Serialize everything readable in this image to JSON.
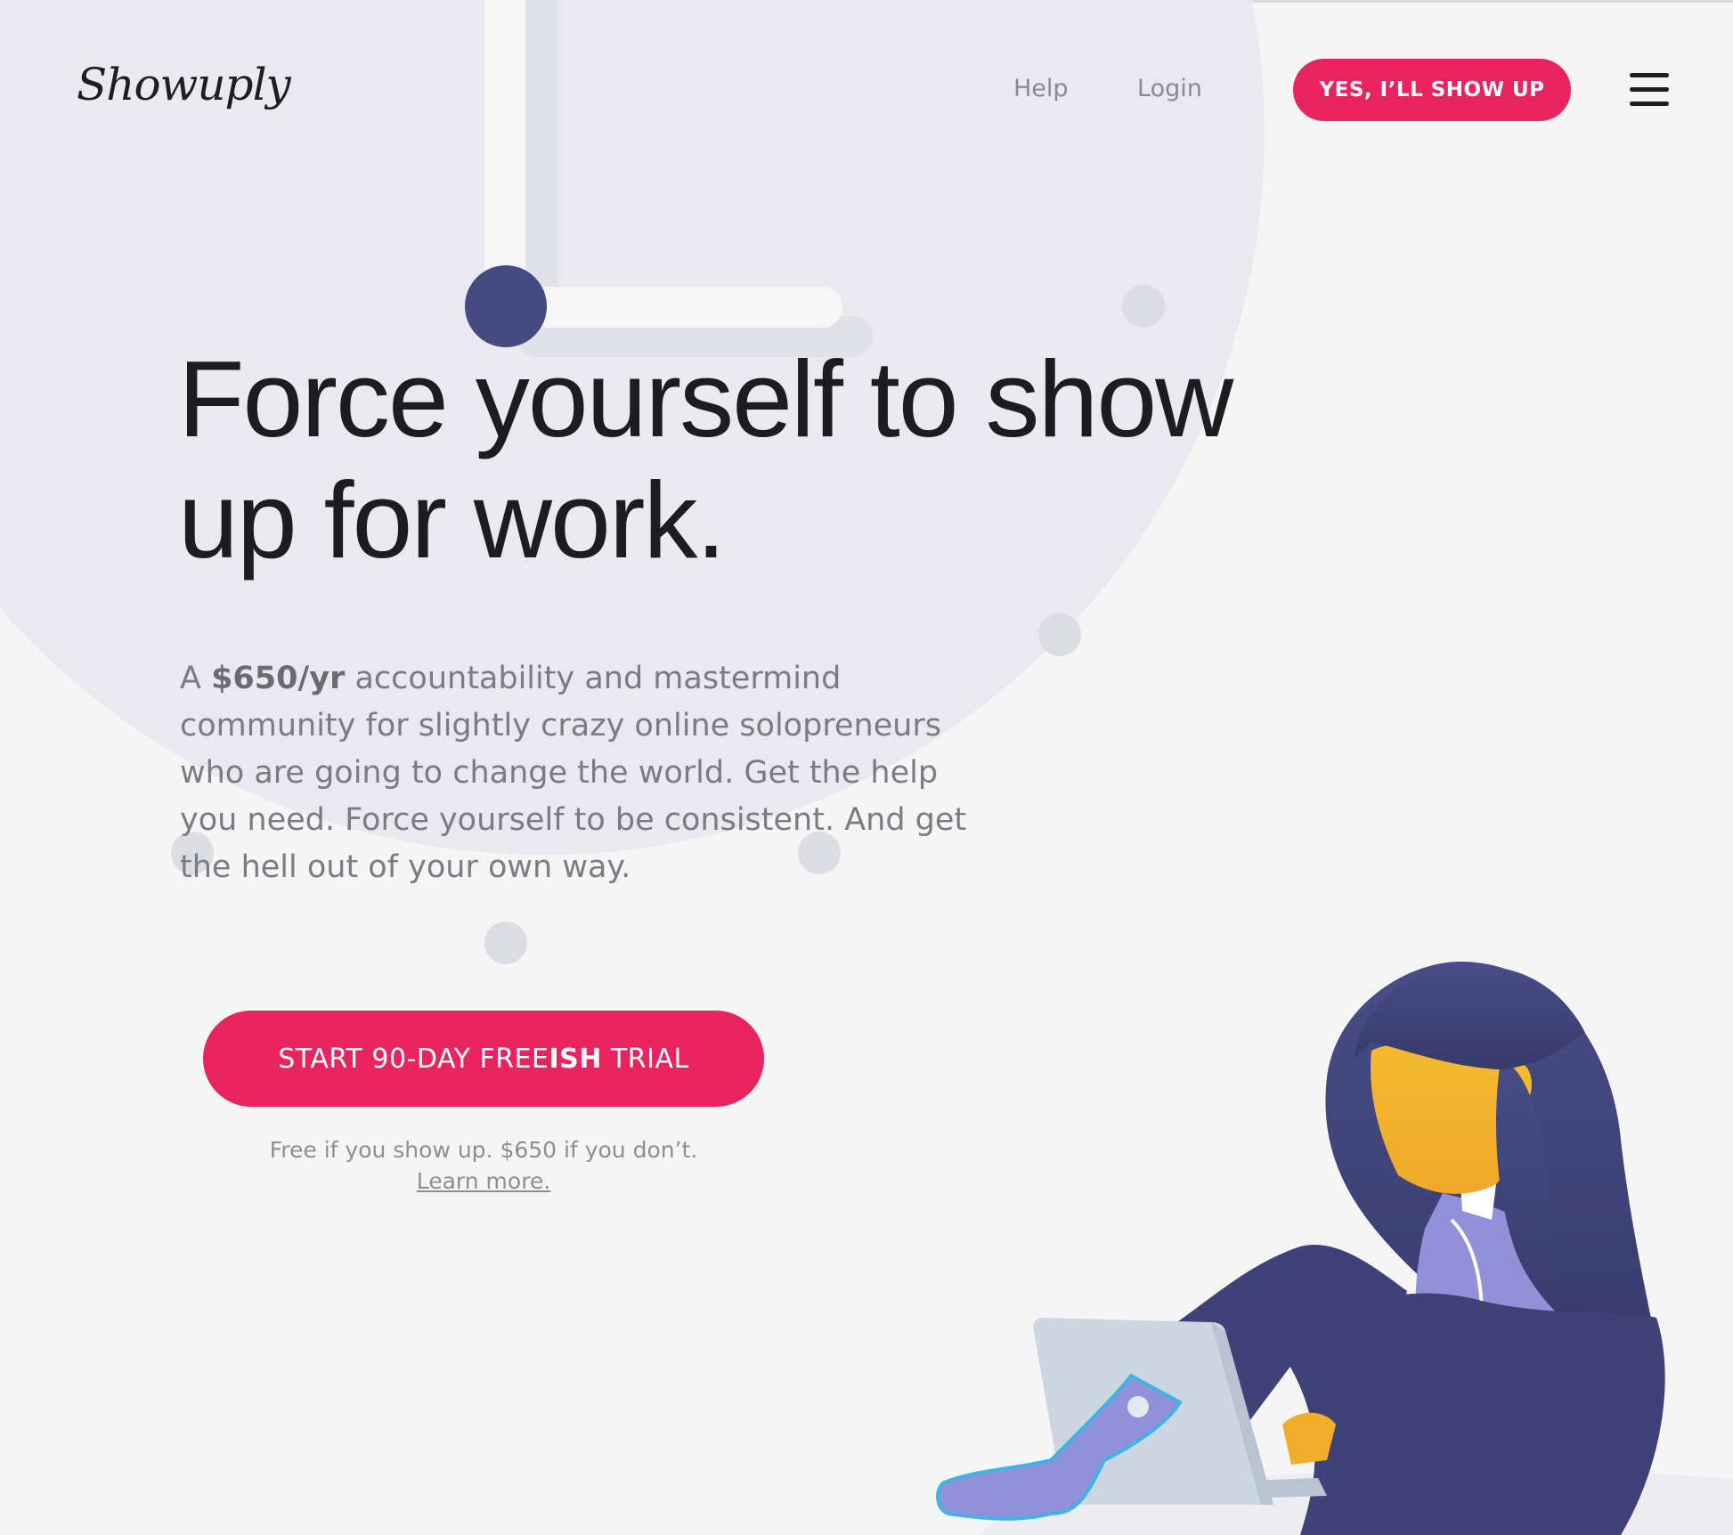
{
  "nav": {
    "logo_text": "Showuply",
    "links": [
      "Help",
      "Login"
    ],
    "cta_label": "YES, I’LL SHOW UP",
    "menu_icon": "hamburger-menu-icon"
  },
  "hero": {
    "headline_line1": "Force yourself to show",
    "headline_line2": "up for work.",
    "lead_prefix": "A ",
    "lead_price": "$650/yr",
    "lead_rest": " accountability and mastermind community for slightly crazy online solopreneurs who are going to change the world. Get the help you need. Force yourself to be consistent. And get the hell out of your own way.",
    "cta": {
      "part1": "START 90-DAY FREE",
      "part2": "ISH",
      "part3": " TRIAL"
    },
    "fine_print": "Free if you show up. $650 if you don’t.",
    "learn_more": "Learn more."
  },
  "colors": {
    "accent": "#e8245f",
    "navy": "#454a82",
    "text_dark": "#1c1c21",
    "text_muted": "#7b7b84",
    "background": "#f5f5f6",
    "clock_face": "#e9e9ef"
  },
  "illustration": {
    "icon": "woman-with-laptop-illustration"
  }
}
